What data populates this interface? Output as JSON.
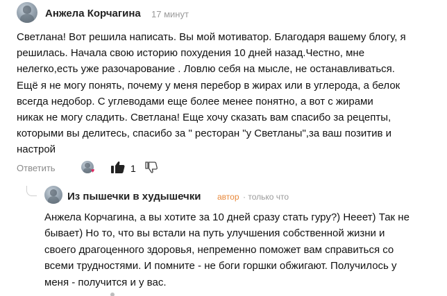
{
  "comment": {
    "author": "Анжела Корчагина",
    "time": "17 минут",
    "text": "Светлана! Вот решила написать. Вы мой мотиватор. Благодаря вашему блогу, я\nрешилась. Начала свою историю похудения 10 дней назад.Честно, мне\nнелегко,есть уже разочарование . Ловлю себя на мысле, не останавливаться.\nЕщё я не могу понять, почему у меня перебор в жирах или в углерода, а белок\nвсегда недобор. С углеводами еще более менее понятно, а вот с жирами\nникак не могу сладить. Светлана! Еще хочу сказать вам спасибо за рецепты,\nкоторыми вы делитесь, спасибо за \" ресторан \"у Светланы\",за ваш позитив и\nнастрой",
    "actions": {
      "reply_label": "Ответить",
      "like_count": "1"
    }
  },
  "reply": {
    "author": "Из пышечки в худышечки",
    "role": "автор",
    "time": "· только что",
    "text": "Анжела Корчагина, а вы хотите за 10 дней сразу стать гуру?) Нееет) Так не\nбывает) Но то, что вы встали на путь улучшения собственной жизни и\nсвоего драгоценного здоровья, непременно поможет вам справиться со\nвсеми трудностями. И помните - не боги горшки обжигают. Получилось у\nменя - получится и у вас."
  },
  "icons": {
    "reaction_heart": "heart-icon",
    "like": "thumbs-up-icon",
    "dislike": "thumbs-down-icon"
  },
  "colors": {
    "role_accent": "#e8883a",
    "reaction_heart": "#e0245e",
    "muted_text": "#8a8a8a"
  }
}
